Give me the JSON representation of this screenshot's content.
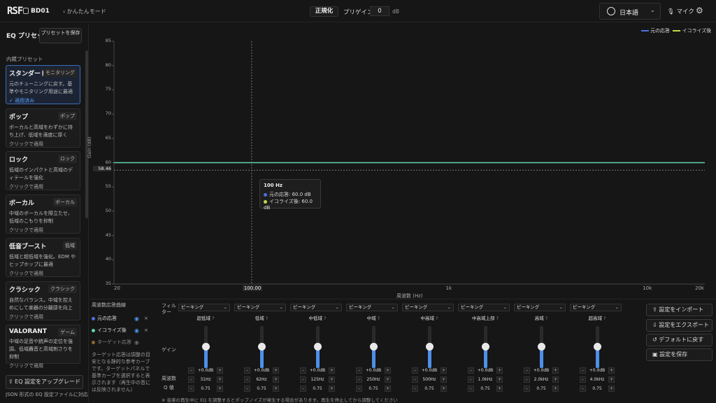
{
  "topbar": {
    "logo": "RSF",
    "device": "BD01",
    "mode_link": "‹ かんたんモード",
    "normalize": "正規化",
    "preamp_label": "プリゲイン",
    "preamp_value": "0",
    "preamp_unit": "dB",
    "language": "日本語",
    "mic": "マイク"
  },
  "sidebar": {
    "title": "EQ プリセット",
    "save_preset": "プリセットを保存",
    "builtin_label": "内蔵プリセット",
    "presets": [
      {
        "name": "スタンダード",
        "tag": "モニタリング",
        "desc": "元のチューニングに戻す。基準やモニタリング用途に最適",
        "foot": "✓ 適用済み"
      },
      {
        "name": "ポップ",
        "tag": "ポップ",
        "desc": "ボーカルと高域をわずかに持ち上げ、低域を適度に厚く",
        "foot": "クリックで適用"
      },
      {
        "name": "ロック",
        "tag": "ロック",
        "desc": "低域のインパクトと高域のディテールを強化",
        "foot": "クリックで適用"
      },
      {
        "name": "ボーカル",
        "tag": "ボーカル",
        "desc": "中域のボーカルを際立たせ、低域のこもりを抑制",
        "foot": "クリックで適用"
      },
      {
        "name": "低音ブースト",
        "tag": "低域",
        "desc": "低域と超低域を強化。EDM やヒップホップに最適",
        "foot": "クリックで適用"
      },
      {
        "name": "クラシック",
        "tag": "クラシック",
        "desc": "自然なバランス。中域を控えめにして楽器の分離感を向上",
        "foot": "クリックで適用"
      },
      {
        "name": "VALORANT",
        "tag": "ゲーム",
        "desc": "中域の足音や銃声の定位を強調、低域轟音と高域刺さりを抑制",
        "foot": "クリックで適用"
      }
    ],
    "upgrade": "⇪ EQ 設定をアップグレード",
    "json_note": "JSON 形式の EQ 設定ファイルに対応"
  },
  "chart_data": {
    "type": "line",
    "xlabel": "周波数 (Hz)",
    "ylabel": "Gain (dB)",
    "x_scale": "log",
    "xlim": [
      20,
      20000
    ],
    "ylim": [
      35,
      85
    ],
    "x_ticks": [
      "20",
      "100.00",
      "1k",
      "10k",
      "20k"
    ],
    "y_ticks": [
      "85",
      "80",
      "75",
      "70",
      "65",
      "60",
      "55",
      "50",
      "45",
      "40",
      "35"
    ],
    "y_marker": "58.46",
    "series": [
      {
        "name": "元の応答",
        "color": "#4e6fe0",
        "x": [
          20,
          20000
        ],
        "y": [
          60,
          60
        ]
      },
      {
        "name": "イコライズ後",
        "color": "#c8d84a",
        "x": [
          20,
          20000
        ],
        "y": [
          60,
          60
        ]
      }
    ],
    "line_color": "#5fd6b0",
    "tooltip": {
      "title": "100 Hz",
      "rows": [
        {
          "label": "元の応答: 60.0 dB",
          "color": "#4e6fe0"
        },
        {
          "label": "イコライズ後: 60.0 dB",
          "color": "#c8d84a"
        }
      ]
    },
    "legend_position": "top-right"
  },
  "curves": {
    "title": "周波数応答曲線",
    "items": [
      {
        "label": "元の応答",
        "color": "#4e6fe0"
      },
      {
        "label": "イコライズ後",
        "color": "#5fd6b0"
      },
      {
        "label": "ターゲット応答",
        "color": "#8a6a2a"
      }
    ],
    "note": "ターゲット応答は調整の目安となる静的な参考カーブです。ターゲットパネルで基準カーブを選択すると表示されます（再生中の音には反映されません）"
  },
  "eq": {
    "filter_label": "フィルター",
    "gain_label": "ゲイン",
    "freq_label": "周波数",
    "q_label": "Q 値",
    "bands": [
      {
        "filter": "ピーキング",
        "name": "超低域",
        "gain": "+0.0dB",
        "freq": "31Hz",
        "q": "0.75",
        "level": 0.5
      },
      {
        "filter": "ピーキング",
        "name": "低域",
        "gain": "+0.0dB",
        "freq": "62Hz",
        "q": "0.75",
        "level": 0.5
      },
      {
        "filter": "ピーキング",
        "name": "中低域",
        "gain": "+0.0dB",
        "freq": "125Hz",
        "q": "0.75",
        "level": 0.5
      },
      {
        "filter": "ピーキング",
        "name": "中域",
        "gain": "+0.0dB",
        "freq": "250Hz",
        "q": "0.75",
        "level": 0.5
      },
      {
        "filter": "ピーキング",
        "name": "中高域",
        "gain": "+0.0dB",
        "freq": "500Hz",
        "q": "0.75",
        "level": 0.5
      },
      {
        "filter": "ピーキング",
        "name": "中高域上部",
        "gain": "+0.0dB",
        "freq": "1.0kHz",
        "q": "0.75",
        "level": 0.5
      },
      {
        "filter": "ピーキング",
        "name": "高域",
        "gain": "+0.0dB",
        "freq": "2.0kHz",
        "q": "0.75",
        "level": 0.5
      },
      {
        "filter": "ピーキング",
        "name": "超高域",
        "gain": "+0.0dB",
        "freq": "4.0kHz",
        "q": "0.75",
        "level": 0.5
      }
    ],
    "warning": "※ 音楽の再生中に EQ を調整するとポップノイズが発生する場合があります。再生を停止してから調整してください"
  },
  "actions": {
    "import": "⇪ 設定をインポート",
    "export": "⇩ 設定をエクスポート",
    "reset": "↺ デフォルトに戻す",
    "save": "▣ 設定を保存"
  }
}
